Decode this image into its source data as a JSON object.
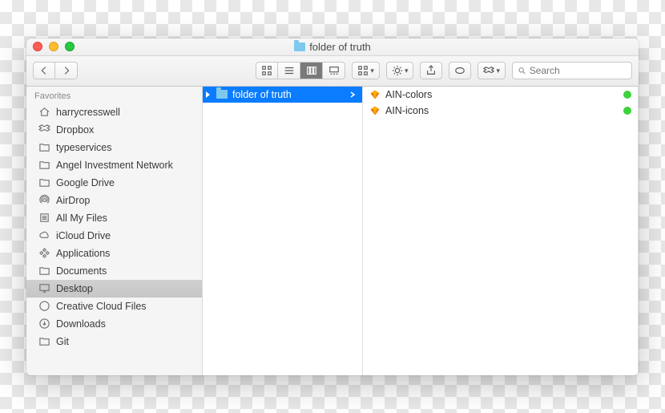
{
  "window": {
    "title": "folder of truth"
  },
  "toolbar": {
    "search_placeholder": "Search"
  },
  "sidebar": {
    "section": "Favorites",
    "items": [
      {
        "label": "harrycresswell",
        "icon": "home"
      },
      {
        "label": "Dropbox",
        "icon": "dropbox"
      },
      {
        "label": "typeservices",
        "icon": "folder"
      },
      {
        "label": "Angel Investment Network",
        "icon": "folder"
      },
      {
        "label": "Google Drive",
        "icon": "folder"
      },
      {
        "label": "AirDrop",
        "icon": "airdrop"
      },
      {
        "label": "All My Files",
        "icon": "allfiles"
      },
      {
        "label": "iCloud Drive",
        "icon": "cloud"
      },
      {
        "label": "Applications",
        "icon": "apps"
      },
      {
        "label": "Documents",
        "icon": "folder"
      },
      {
        "label": "Desktop",
        "icon": "desktop",
        "selected": true
      },
      {
        "label": "Creative Cloud Files",
        "icon": "cc"
      },
      {
        "label": "Downloads",
        "icon": "downloads"
      },
      {
        "label": "Git",
        "icon": "folder"
      }
    ]
  },
  "column1": {
    "items": [
      {
        "label": "folder of truth",
        "selected": true,
        "hasChildren": true
      }
    ]
  },
  "column2": {
    "items": [
      {
        "label": "AIN-colors",
        "tag": "#3cd33c"
      },
      {
        "label": "AIN-icons",
        "tag": "#3cd33c"
      }
    ]
  }
}
